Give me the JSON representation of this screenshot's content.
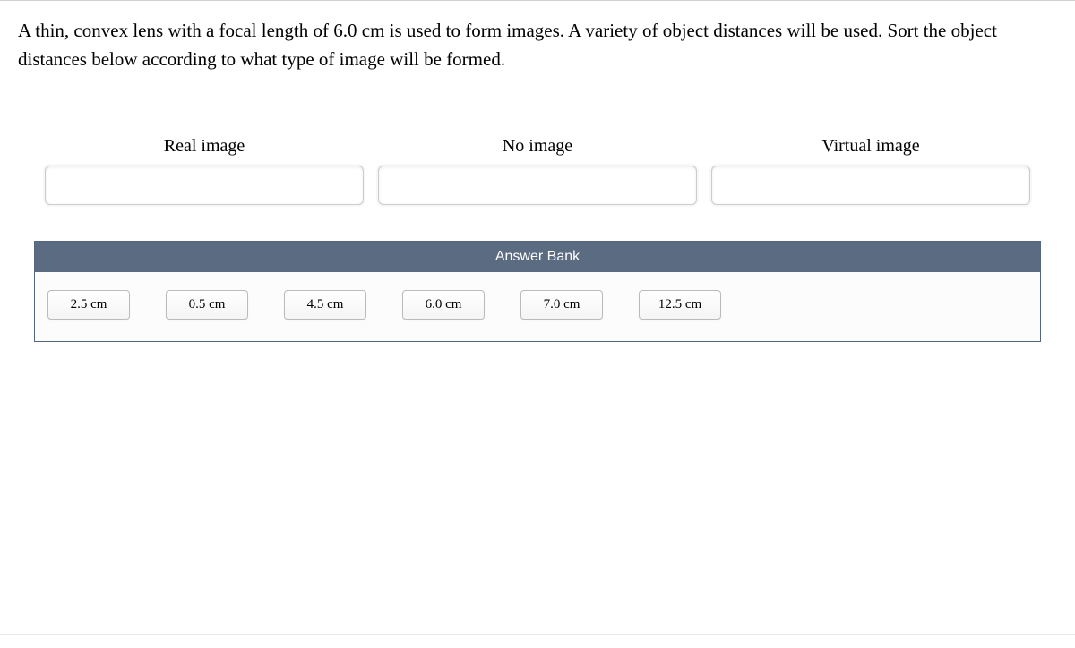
{
  "question": "A thin, convex lens with a focal length of 6.0 cm is used to form images. A variety of object distances will be used. Sort the object distances below according to what type of image will be formed.",
  "categories": [
    {
      "label": "Real image"
    },
    {
      "label": "No image"
    },
    {
      "label": "Virtual image"
    }
  ],
  "answer_bank": {
    "title": "Answer Bank",
    "items": [
      "2.5 cm",
      "0.5 cm",
      "4.5 cm",
      "6.0 cm",
      "7.0 cm",
      "12.5 cm"
    ]
  }
}
